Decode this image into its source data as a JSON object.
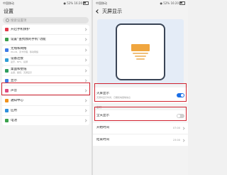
{
  "left": {
    "status": {
      "left": "中国移动",
      "right": "● 52% 16:20"
    },
    "title": "设置",
    "search_placeholder": "搜索设置项",
    "card1": [
      {
        "label": "开启手机保护",
        "sub": "",
        "icon": "shield-icon",
        "color": "#e2394a"
      },
      {
        "label": "设置“查找我的手机”功能",
        "sub": "",
        "icon": "phone-search-icon",
        "color": "#3a9d4b"
      }
    ],
    "card2": [
      {
        "label": "无线和网络",
        "sub": "WLAN、双卡管理、移动网络",
        "icon": "wifi-icon",
        "color": "#3d7be6"
      },
      {
        "label": "设备连接",
        "sub": "蓝牙、NFC、投屏",
        "icon": "device-connection-icon",
        "color": "#2e9cd6"
      }
    ],
    "card3": [
      {
        "label": "桌面和壁纸",
        "sub": "主题、壁纸、灭屏显示",
        "icon": "desktop-icon",
        "color": "#2e9d5c"
      },
      {
        "label": "显示",
        "sub": "",
        "icon": "display-icon",
        "color": "#3d7be6"
      },
      {
        "label": "声音",
        "sub": "",
        "icon": "sound-icon",
        "color": "#e0497e"
      },
      {
        "label": "通知中心",
        "sub": "",
        "icon": "notification-icon",
        "color": "#f0921e"
      },
      {
        "label": "应用",
        "sub": "",
        "icon": "apps-icon",
        "color": "#2d8fdc"
      },
      {
        "label": "电池",
        "sub": "",
        "icon": "battery-icon",
        "color": "#3aa24c"
      }
    ]
  },
  "right": {
    "status": {
      "left": "中国移动",
      "right": "● 52% 16:20"
    },
    "title": "灭屏显示",
    "aod": {
      "label": "灭屏显示",
      "sub": "灭屏时显示时间、日期和电量等信息",
      "on": true
    },
    "section": "定时",
    "allday": {
      "label": "全天显示",
      "on": false
    },
    "start": {
      "label": "开始时间",
      "value": "07:00"
    },
    "end": {
      "label": "结束时间",
      "value": "23:00"
    },
    "colors": {
      "accent": "#1a6ee6",
      "highlight": "#d12430",
      "phone_frame": "#3a4556",
      "art": "#f0a63f"
    }
  }
}
